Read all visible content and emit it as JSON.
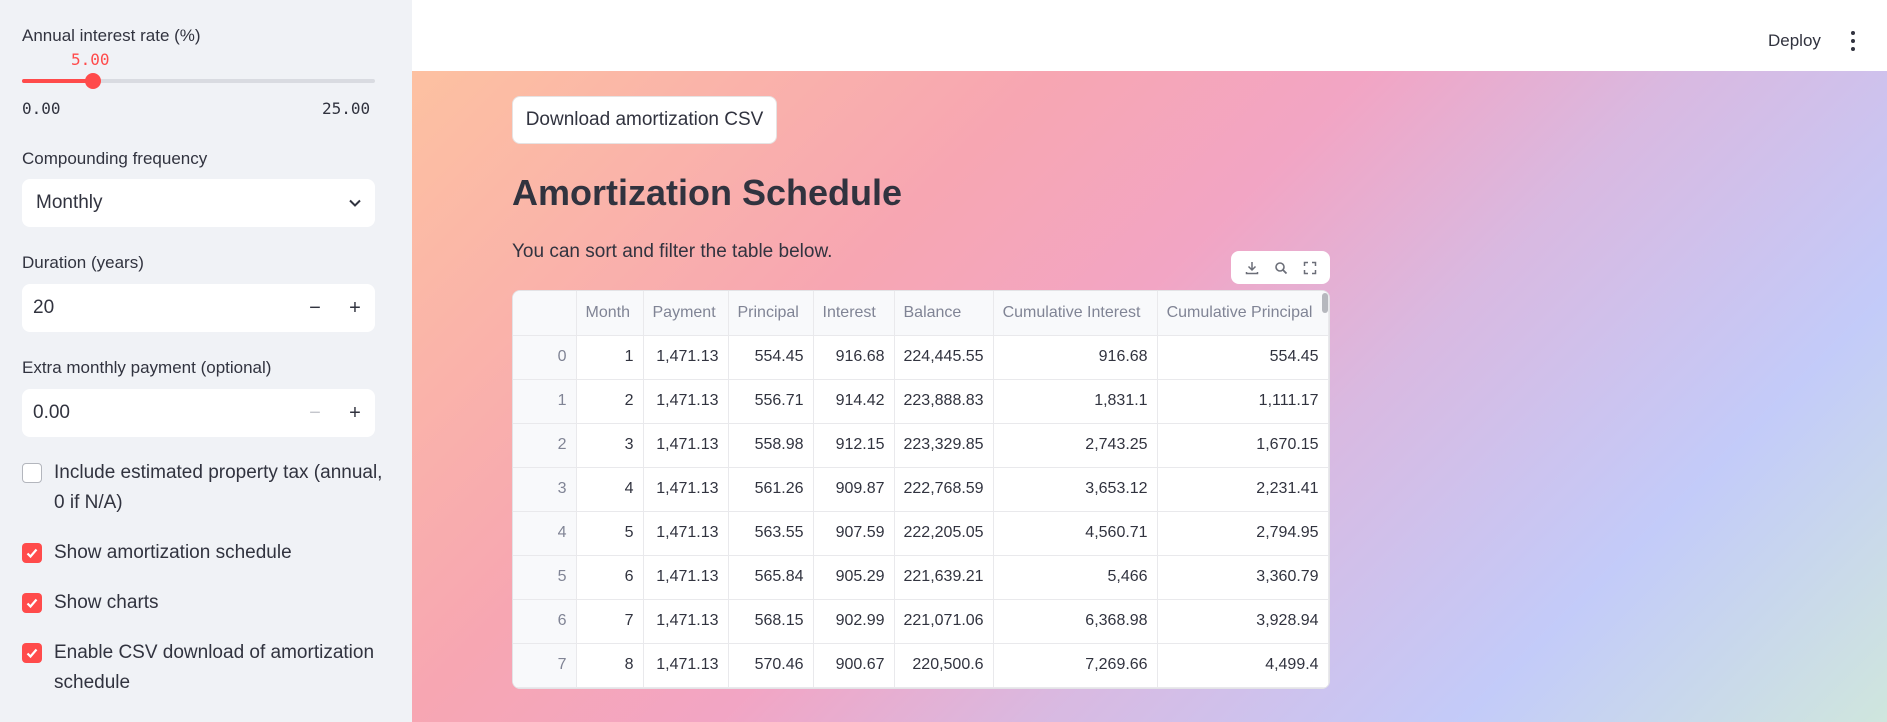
{
  "sidebar": {
    "interest": {
      "label": "Annual interest rate (%)",
      "value": "5.00",
      "min": "0.00",
      "max": "25.00",
      "fraction": 0.2
    },
    "compounding": {
      "label": "Compounding frequency",
      "value": "Monthly"
    },
    "duration": {
      "label": "Duration (years)",
      "value": "20"
    },
    "extra": {
      "label": "Extra monthly payment (optional)",
      "value": "0.00"
    },
    "checkboxes": [
      {
        "label": "Include estimated property tax (annual, 0 if N/A)",
        "checked": false
      },
      {
        "label": "Show amortization schedule",
        "checked": true
      },
      {
        "label": "Show charts",
        "checked": true
      },
      {
        "label": "Enable CSV download of amortization schedule",
        "checked": true
      }
    ]
  },
  "header": {
    "deploy_label": "Deploy"
  },
  "main": {
    "download_label": "Download amortization CSV",
    "title": "Amortization Schedule",
    "subtitle": "You can sort and filter the table below."
  },
  "table": {
    "columns": [
      "",
      "Month",
      "Payment",
      "Principal",
      "Interest",
      "Balance",
      "Cumulative Interest",
      "Cumulative Principal"
    ],
    "rows": [
      [
        "0",
        "1",
        "1,471.13",
        "554.45",
        "916.68",
        "224,445.55",
        "916.68",
        "554.45"
      ],
      [
        "1",
        "2",
        "1,471.13",
        "556.71",
        "914.42",
        "223,888.83",
        "1,831.1",
        "1,111.17"
      ],
      [
        "2",
        "3",
        "1,471.13",
        "558.98",
        "912.15",
        "223,329.85",
        "2,743.25",
        "1,670.15"
      ],
      [
        "3",
        "4",
        "1,471.13",
        "561.26",
        "909.87",
        "222,768.59",
        "3,653.12",
        "2,231.41"
      ],
      [
        "4",
        "5",
        "1,471.13",
        "563.55",
        "907.59",
        "222,205.05",
        "4,560.71",
        "2,794.95"
      ],
      [
        "5",
        "6",
        "1,471.13",
        "565.84",
        "905.29",
        "221,639.21",
        "5,466",
        "3,360.79"
      ],
      [
        "6",
        "7",
        "1,471.13",
        "568.15",
        "902.99",
        "221,071.06",
        "6,368.98",
        "3,928.94"
      ],
      [
        "7",
        "8",
        "1,471.13",
        "570.46",
        "900.67",
        "220,500.6",
        "7,269.66",
        "4,499.4"
      ]
    ]
  },
  "colors": {
    "accent": "#ff4b4b",
    "sidebar_bg": "#f0f2f6",
    "text": "#31333f"
  },
  "icons": {
    "chevron": "chevron-down-icon",
    "download": "download-icon",
    "search": "search-icon",
    "fullscreen": "fullscreen-icon",
    "kebab": "kebab-menu-icon",
    "check": "check-icon"
  }
}
